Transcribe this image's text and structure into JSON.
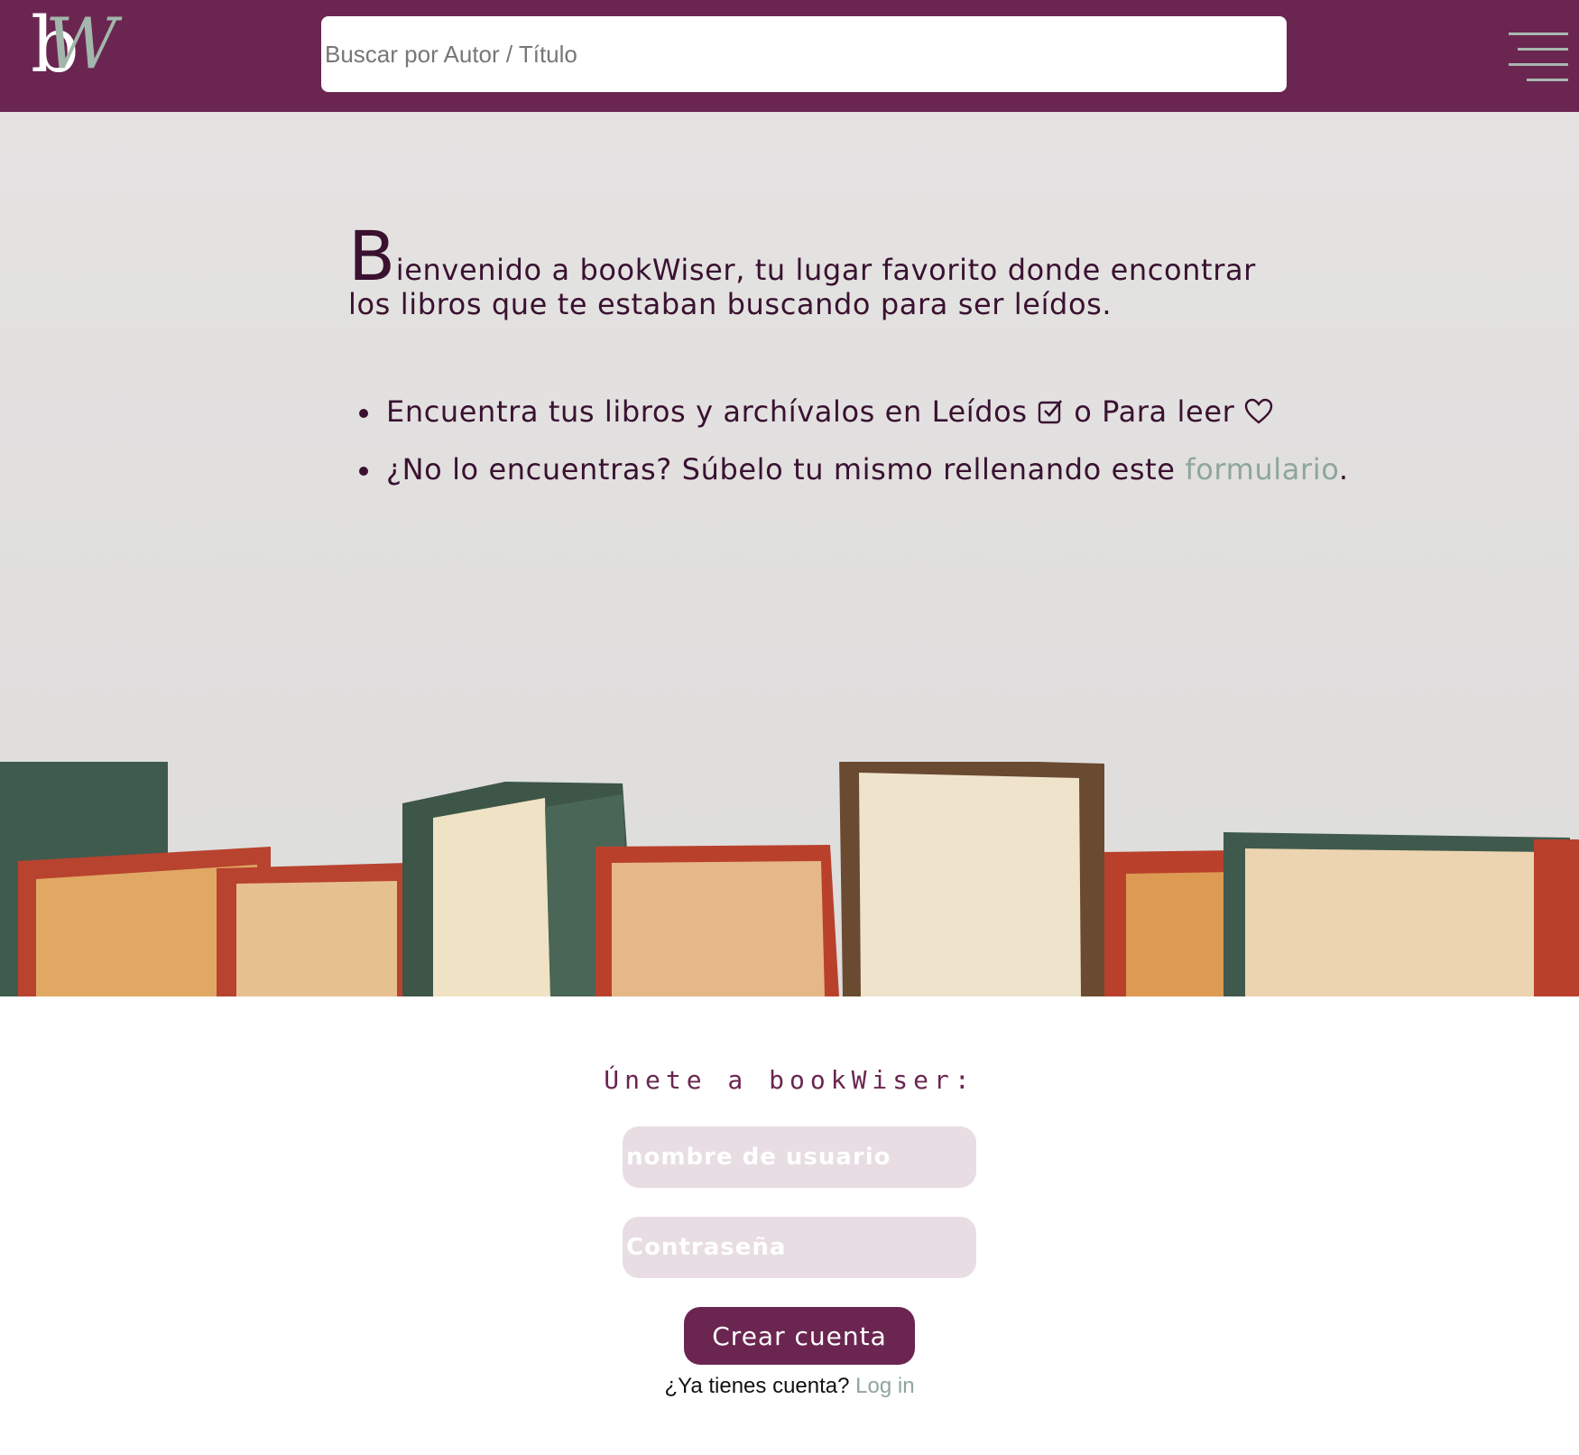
{
  "header": {
    "logo": "bW",
    "search_placeholder": "Buscar por Autor / Título",
    "menu_icon": "hamburger-menu-icon"
  },
  "hero": {
    "welcome_cap": "B",
    "welcome_rest": "ienvenido a bookWiser, tu lugar favorito donde encontrar los libros que te estaban buscando para ser leídos.",
    "bullet1_before": "Encuentra tus libros y archívalos en Leídos",
    "bullet1_mid": "o Para leer",
    "bullet2_before": "¿No lo encuentras? Súbelo tu mismo rellenando este",
    "bullet2_link": "formulario",
    "bullet2_after": ".",
    "icons": [
      "checkbox-icon",
      "heart-icon"
    ]
  },
  "signup": {
    "title": "Únete a bookWiser:",
    "username_placeholder": "nombre de usuario",
    "password_placeholder": "Contraseña",
    "create_label": "Crear cuenta",
    "have_account_text": "¿Ya tienes cuenta?",
    "login_link": "Log in"
  },
  "colors": {
    "brand": "#6a2650",
    "accent_link": "#8ea69b",
    "hero_bg": "#e2e1e0",
    "input_bg": "#e7dde2"
  }
}
